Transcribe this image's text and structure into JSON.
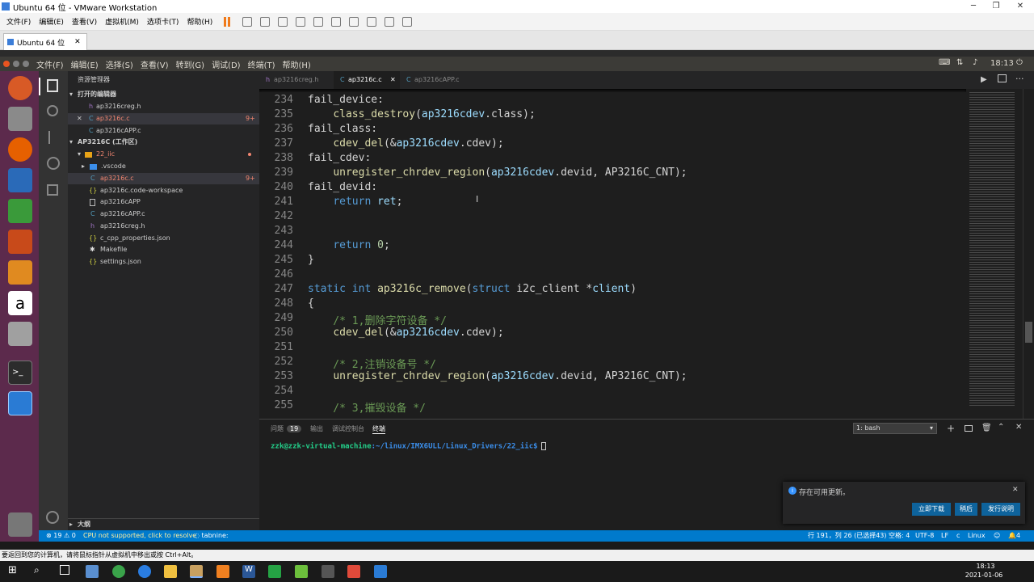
{
  "vm": {
    "title": "Ubuntu 64 位 - VMware Workstation",
    "menu": [
      "文件(F)",
      "编辑(E)",
      "查看(V)",
      "虚拟机(M)",
      "选项卡(T)",
      "帮助(H)"
    ],
    "tab": "Ubuntu 64 位",
    "hint": "要返回到您的计算机，请将鼠标指针从虚拟机中移出或按 Ctrl+Alt。"
  },
  "ubuntu": {
    "menu": [
      "文件(F)",
      "编辑(E)",
      "选择(S)",
      "查看(V)",
      "转到(G)",
      "调试(D)",
      "终端(T)",
      "帮助(H)"
    ],
    "clock": "18:13"
  },
  "sidebar": {
    "header": "资源管理器",
    "open_editors_title": "打开的编辑器",
    "open_editors": [
      {
        "name": "ap3216creg.h",
        "icon": "h"
      },
      {
        "name": "ap3216c.c",
        "icon": "C",
        "badge": "9+"
      },
      {
        "name": "ap3216cAPP.c",
        "icon": "C"
      }
    ],
    "workspace_title": "AP3216C (工作区)",
    "folder": "22_iic",
    "files": [
      {
        "name": ".vscode",
        "icon": "folder"
      },
      {
        "name": "ap3216c.c",
        "icon": "C",
        "badge": "9+"
      },
      {
        "name": "ap3216c.code-workspace",
        "icon": "{}"
      },
      {
        "name": "ap3216cAPP",
        "icon": "file"
      },
      {
        "name": "ap3216cAPP.c",
        "icon": "C"
      },
      {
        "name": "ap3216creg.h",
        "icon": "h"
      },
      {
        "name": "c_cpp_properties.json",
        "icon": "{}"
      },
      {
        "name": "Makefile",
        "icon": "make"
      },
      {
        "name": "settings.json",
        "icon": "{}"
      }
    ],
    "outline": "大纲"
  },
  "tabs": [
    {
      "label": "ap3216creg.h",
      "icon": "h"
    },
    {
      "label": "ap3216c.c",
      "icon": "C",
      "active": true
    },
    {
      "label": "ap3216cAPP.c",
      "icon": "C"
    }
  ],
  "code": [
    {
      "n": "234",
      "t": "fail_device:"
    },
    {
      "n": "235",
      "t": "    class_destroy(ap3216cdev.class);"
    },
    {
      "n": "236",
      "t": "fail_class:"
    },
    {
      "n": "237",
      "t": "    cdev_del(&ap3216cdev.cdev);"
    },
    {
      "n": "238",
      "t": "fail_cdev:"
    },
    {
      "n": "239",
      "t": "    unregister_chrdev_region(ap3216cdev.devid, AP3216C_CNT);"
    },
    {
      "n": "240",
      "t": "fail_devid:"
    },
    {
      "n": "241",
      "t": "    return ret;"
    },
    {
      "n": "242",
      "t": ""
    },
    {
      "n": "243",
      "t": ""
    },
    {
      "n": "244",
      "t": "    return 0;"
    },
    {
      "n": "245",
      "t": "}"
    },
    {
      "n": "246",
      "t": ""
    },
    {
      "n": "247",
      "t": "static int ap3216c_remove(struct i2c_client *client)"
    },
    {
      "n": "248",
      "t": "{"
    },
    {
      "n": "249",
      "t": "    /* 1,删除字符设备 */"
    },
    {
      "n": "250",
      "t": "    cdev_del(&ap3216cdev.cdev);"
    },
    {
      "n": "251",
      "t": ""
    },
    {
      "n": "252",
      "t": "    /* 2,注销设备号 */"
    },
    {
      "n": "253",
      "t": "    unregister_chrdev_region(ap3216cdev.devid, AP3216C_CNT);"
    },
    {
      "n": "254",
      "t": ""
    },
    {
      "n": "255",
      "t": "    /* 3,摧毁设备 */"
    }
  ],
  "panel": {
    "tabs": [
      "问题",
      "输出",
      "调试控制台",
      "终端"
    ],
    "problems_count": "19",
    "terminal_select": "1: bash",
    "prompt_user": "zzk@zzk-virtual-machine",
    "prompt_path": ":~/linux/IMX6ULL/Linux_Drivers/22_iic$"
  },
  "status": {
    "errors": "19",
    "warnings": "0",
    "cpu_msg": "CPU not supported, click to resolve",
    "tabnine": "tabnine:",
    "position": "行 191，列 26 (已选择43)",
    "spaces": "空格: 4",
    "encoding": "UTF-8",
    "eol": "LF",
    "lang": "c",
    "os": "Linux",
    "bell": "4"
  },
  "notification": {
    "message": "存在可用更新。",
    "buttons": [
      "立即下载",
      "稍后",
      "发行说明"
    ]
  },
  "taskbar": {
    "time": "18:13",
    "date": "2021-01-06"
  },
  "colors": {
    "accent": "#007acc",
    "keyword": "#569cd6",
    "function": "#dcdcaa",
    "comment": "#6a9955",
    "variable": "#9cdcfe"
  }
}
